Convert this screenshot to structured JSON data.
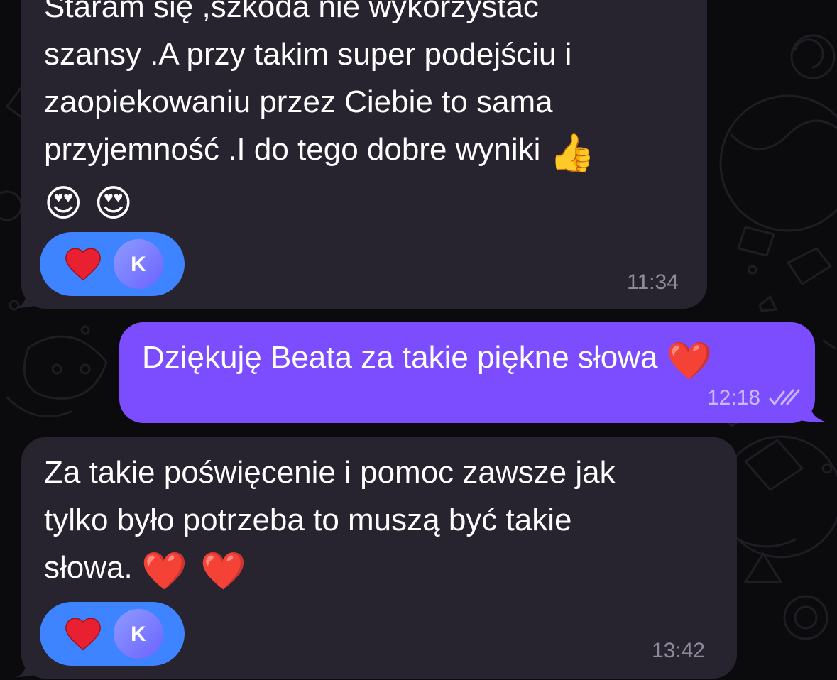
{
  "messages": [
    {
      "direction": "incoming",
      "lines": [
        "Staram się ,szkoda nie wykorzystać",
        "szansy .A przy takim super podejściu i",
        "zaopiekowaniu przez Ciebie to sama",
        "przyjemność .I do tego dobre wyniki"
      ],
      "line4_emoji": "👍",
      "line5_emoji": [
        "😍",
        "😍"
      ],
      "reaction_emoji": "❤️",
      "reaction_avatar": "K",
      "time": "11:34"
    },
    {
      "direction": "outgoing",
      "text": "Dziękuję Beata za takie piękne słowa",
      "emoji": "❤️",
      "time": "12:18",
      "status": "read"
    },
    {
      "direction": "incoming",
      "lines": [
        "Za takie poświęcenie i pomoc zawsze jak",
        "tylko było potrzeba to muszą być takie",
        "słowa."
      ],
      "line3_emoji": [
        "❤️",
        "❤️"
      ],
      "reaction_emoji": "❤️",
      "reaction_avatar": "K",
      "time": "13:42"
    }
  ],
  "colors": {
    "background": "#0b0b0d",
    "incoming_bubble": "#272430",
    "outgoing_bubble": "#7b4dff",
    "reaction_pill": "#3e83ff",
    "heart": "#e8202f"
  },
  "icons": {
    "read_status": "double-check-icon",
    "reaction": "red-heart-icon"
  }
}
